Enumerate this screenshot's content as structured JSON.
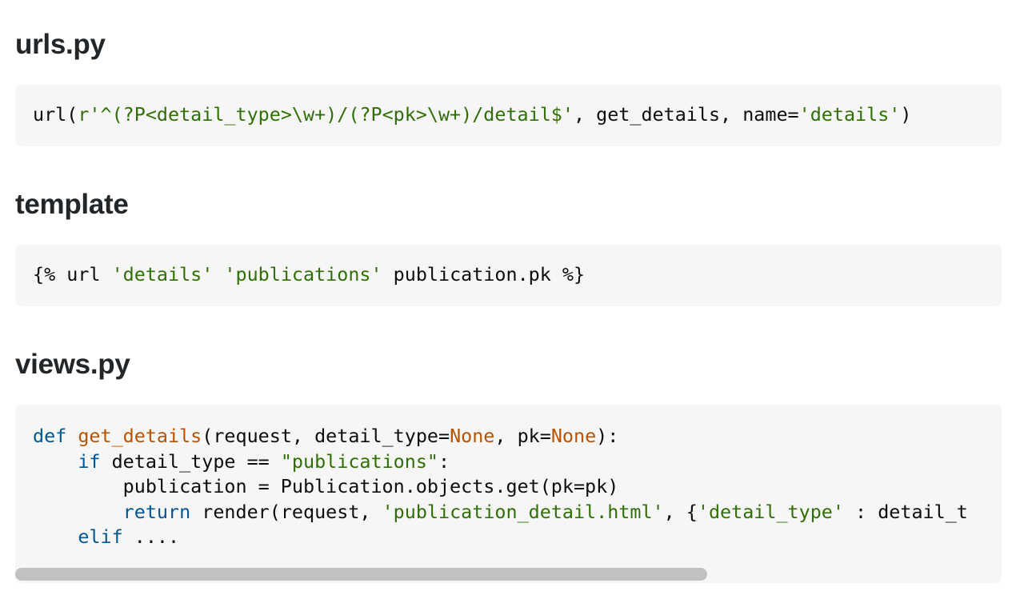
{
  "sections": [
    {
      "heading": "urls.py",
      "code": {
        "lines": [
          [
            {
              "text": "url(",
              "cls": "pln"
            },
            {
              "text": "r'^(?P<detail_type>\\w+)/(?P<pk>\\w+)/detail$'",
              "cls": "str"
            },
            {
              "text": ", get_details, name=",
              "cls": "pln"
            },
            {
              "text": "'details'",
              "cls": "str"
            },
            {
              "text": ")",
              "cls": "pln"
            }
          ]
        ]
      }
    },
    {
      "heading": "template",
      "code": {
        "lines": [
          [
            {
              "text": "{% url ",
              "cls": "pln"
            },
            {
              "text": "'details'",
              "cls": "str"
            },
            {
              "text": " ",
              "cls": "pln"
            },
            {
              "text": "'publications'",
              "cls": "str"
            },
            {
              "text": " publication.pk %}",
              "cls": "pln"
            }
          ]
        ]
      }
    },
    {
      "heading": "views.py",
      "code": {
        "lines": [
          [
            {
              "text": "def",
              "cls": "kw"
            },
            {
              "text": " ",
              "cls": "pln"
            },
            {
              "text": "get_details",
              "cls": "fn"
            },
            {
              "text": "(request, detail_type=",
              "cls": "pln"
            },
            {
              "text": "None",
              "cls": "lit"
            },
            {
              "text": ", pk=",
              "cls": "pln"
            },
            {
              "text": "None",
              "cls": "lit"
            },
            {
              "text": "):",
              "cls": "pln"
            }
          ],
          [
            {
              "text": "    ",
              "cls": "pln"
            },
            {
              "text": "if",
              "cls": "kw"
            },
            {
              "text": " detail_type == ",
              "cls": "pln"
            },
            {
              "text": "\"publications\"",
              "cls": "str"
            },
            {
              "text": ":",
              "cls": "pln"
            }
          ],
          [
            {
              "text": "        publication = Publication.objects.get(pk=pk)",
              "cls": "pln"
            }
          ],
          [
            {
              "text": "        ",
              "cls": "pln"
            },
            {
              "text": "return",
              "cls": "kw"
            },
            {
              "text": " render(request, ",
              "cls": "pln"
            },
            {
              "text": "'publication_detail.html'",
              "cls": "str"
            },
            {
              "text": ", {",
              "cls": "pln"
            },
            {
              "text": "'detail_type'",
              "cls": "str"
            },
            {
              "text": " : detail_t",
              "cls": "pln"
            }
          ],
          [
            {
              "text": "    ",
              "cls": "pln"
            },
            {
              "text": "elif",
              "cls": "kw"
            },
            {
              "text": " ....",
              "cls": "pln"
            }
          ]
        ],
        "scrollbar": {
          "visible_fraction": 0.7,
          "scroll_position": 0
        }
      }
    }
  ]
}
